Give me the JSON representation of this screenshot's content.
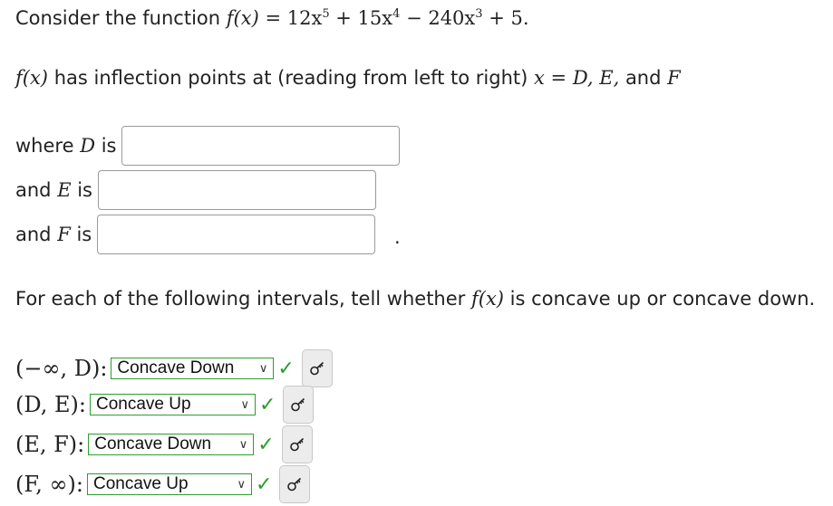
{
  "intro": {
    "text": "Consider the function ",
    "func_lhs": "f(x)",
    "eq": " = ",
    "expr_parts": {
      "c1": "12x",
      "e1": "5",
      "p1": " + 15x",
      "e2": "4",
      "p2": " − 240x",
      "e3": "3",
      "p3": " + 5."
    }
  },
  "inflection": {
    "fx": "f(x)",
    "text": " has inflection points at (reading from left to right) ",
    "xvar": "x",
    "eq": " = ",
    "vars": "D, E,",
    "and_text": " and ",
    "last": "F"
  },
  "answers": [
    {
      "prefix": "where ",
      "var": "D",
      "suffix": " is",
      "value": ""
    },
    {
      "prefix": "and ",
      "var": "E",
      "suffix": " is",
      "value": ""
    },
    {
      "prefix": "and ",
      "var": "F",
      "suffix": " is",
      "value": ""
    }
  ],
  "period": ".",
  "question": {
    "text1": "For each of the following intervals, tell whether ",
    "fx": "f(x)",
    "text2": " is concave up or concave down."
  },
  "intervals": [
    {
      "label": "(−∞, D):",
      "selected": "Concave Down",
      "status": "correct"
    },
    {
      "label": "(D, E):",
      "selected": "Concave Up",
      "status": "correct"
    },
    {
      "label": "(E, F):",
      "selected": "Concave Down",
      "status": "correct"
    },
    {
      "label": "(F, ∞):",
      "selected": "Concave Up",
      "status": "correct"
    }
  ],
  "icons": {
    "check": "checkmark-icon",
    "key": "key-icon"
  },
  "colors": {
    "correct": "#2a9d2a",
    "select_border": "#2e9d2e"
  }
}
